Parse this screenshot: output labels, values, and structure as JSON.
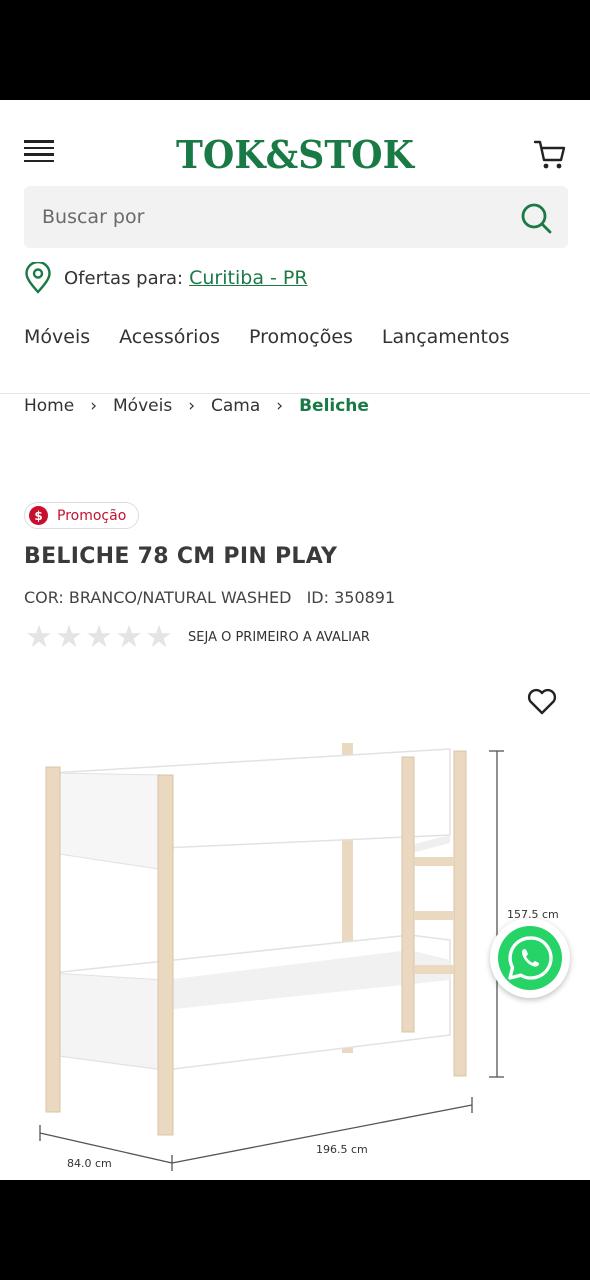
{
  "header": {
    "menu_icon": "hamburger-menu-icon",
    "logo_text": "TOK&STOK",
    "cart_icon": "shopping-cart-icon"
  },
  "search": {
    "placeholder": "Buscar por",
    "icon": "search-icon"
  },
  "location": {
    "icon": "location-pin-icon",
    "label": "Ofertas para:",
    "city": "Curitiba - PR"
  },
  "nav": {
    "items": [
      "Móveis",
      "Acessórios",
      "Promoções",
      "Lançamentos"
    ]
  },
  "breadcrumb": {
    "items": [
      "Home",
      "Móveis",
      "Cama"
    ],
    "current": "Beliche",
    "separator": "›"
  },
  "product": {
    "badge": "Promoção",
    "badge_symbol": "$",
    "title": "BELICHE 78 CM PIN PLAY",
    "color": "COR: BRANCO/NATURAL WASHED",
    "id": "ID: 350891",
    "rating_value": 0,
    "rating_max": 5,
    "rating_cta": "SEJA O PRIMEIRO A AVALIAR",
    "dimensions": {
      "height": "157.5 cm",
      "length": "196.5 cm",
      "depth": "84.0 cm"
    }
  },
  "colors": {
    "brand_green": "#1a7a46",
    "promo_red": "#c8102e",
    "whatsapp_green": "#25d366"
  },
  "floating": {
    "whatsapp_icon": "whatsapp-icon",
    "favorite_icon": "heart-icon"
  }
}
